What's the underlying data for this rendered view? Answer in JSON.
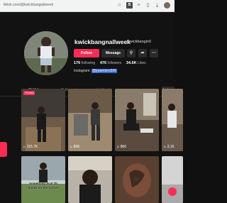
{
  "browser": {
    "url": "tiktok.com/@kwickbangiallweek",
    "icons": [
      "star-icon",
      "extension-icon",
      "puzzle-icon",
      "sidebar-icon",
      "download-icon",
      "profile-avatar"
    ]
  },
  "profile": {
    "username": "kwickbangnallweek",
    "nickname": "Kwickbangin0",
    "follow_label": "Follow",
    "message_label": "Message",
    "following_count": "176",
    "following_label": "following",
    "followers_count": "476",
    "followers_label": "followers",
    "likes_count": "34.6K",
    "likes_label": "Likes",
    "bio_prefix": "Instagram",
    "bio_handle": "@jrpantiers566"
  },
  "tabs": [
    {
      "label": "Videos",
      "icon": "grid-icon",
      "active": true
    },
    {
      "label": "Reposts",
      "icon": "repost-icon",
      "active": false
    },
    {
      "label": "Liked",
      "icon": "heart-icon",
      "active": false
    }
  ],
  "sort_label": "Lates",
  "videos": [
    {
      "views": "115.7K",
      "pinned": true,
      "badge": "Pinned"
    },
    {
      "views": "806"
    },
    {
      "views": "866"
    },
    {
      "views": "3,16"
    },
    {
      "views": "",
      "overlay": "Somebody Scal 2b bucks on the corner"
    },
    {
      "views": ""
    },
    {
      "views": ""
    },
    {
      "views": ""
    }
  ],
  "colors": {
    "accent": "#fe2c55",
    "background": "#121212"
  }
}
